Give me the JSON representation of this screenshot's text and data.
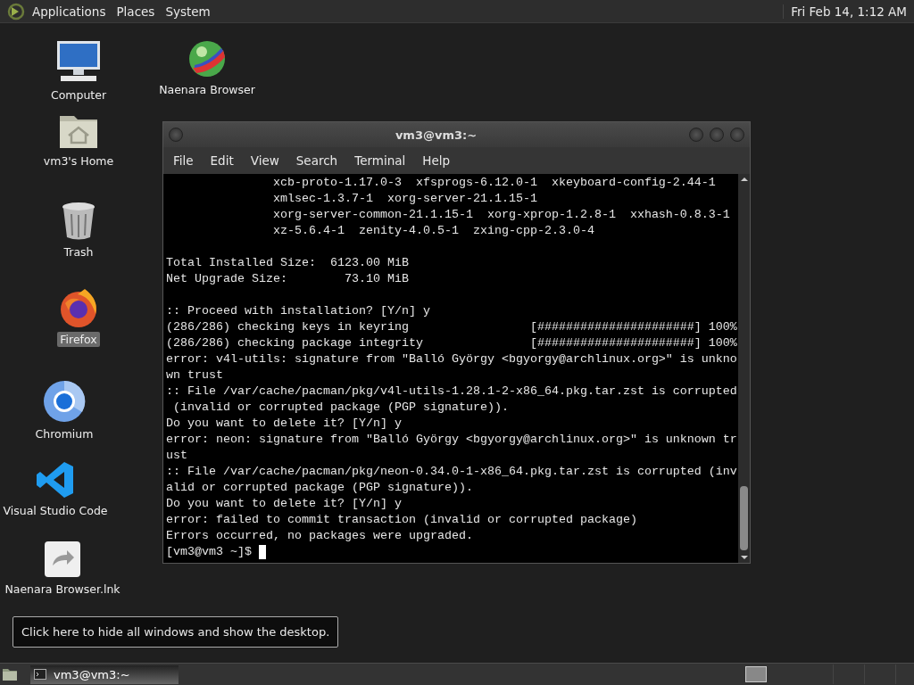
{
  "top_panel": {
    "menus": [
      "Applications",
      "Places",
      "System"
    ],
    "clock": "Fri Feb 14,  1:12 AM"
  },
  "desktop_icons": [
    {
      "kind": "computer",
      "label": "Computer",
      "selected": false
    },
    {
      "kind": "globe",
      "label": "Naenara Browser",
      "selected": false
    },
    {
      "kind": "home",
      "label": "vm3's Home",
      "selected": false
    },
    {
      "kind": "trash",
      "label": "Trash",
      "selected": false
    },
    {
      "kind": "firefox",
      "label": "Firefox",
      "selected": true
    },
    {
      "kind": "chromium",
      "label": "Chromium",
      "selected": false
    },
    {
      "kind": "vscode",
      "label": "Visual Studio Code",
      "selected": false
    },
    {
      "kind": "link",
      "label": "Naenara Browser.lnk",
      "selected": false
    }
  ],
  "terminal": {
    "title": "vm3@vm3:~",
    "menu": [
      "File",
      "Edit",
      "View",
      "Search",
      "Terminal",
      "Help"
    ],
    "blocks": [
      [
        "               xcb-proto-1.17.0-3  xfsprogs-6.12.0-1  xkeyboard-config-2.44-1",
        "               xmlsec-1.3.7-1  xorg-server-21.1.15-1",
        "               xorg-server-common-21.1.15-1  xorg-xprop-1.2.8-1  xxhash-0.8.3-1",
        "               xz-5.6.4-1  zenity-4.0.5-1  zxing-cpp-2.3.0-4"
      ],
      [
        "Total Installed Size:  6123.00 MiB",
        "Net Upgrade Size:        73.10 MiB"
      ],
      [
        ":: Proceed with installation? [Y/n] y",
        "(286/286) checking keys in keyring                 [######################] 100%",
        "(286/286) checking package integrity               [######################] 100%",
        "error: v4l-utils: signature from \"Balló György <bgyorgy@archlinux.org>\" is unkno",
        "wn trust",
        ":: File /var/cache/pacman/pkg/v4l-utils-1.28.1-2-x86_64.pkg.tar.zst is corrupted",
        " (invalid or corrupted package (PGP signature)).",
        "Do you want to delete it? [Y/n] y",
        "error: neon: signature from \"Balló György <bgyorgy@archlinux.org>\" is unknown tr",
        "ust",
        ":: File /var/cache/pacman/pkg/neon-0.34.0-1-x86_64.pkg.tar.zst is corrupted (inv",
        "alid or corrupted package (PGP signature)).",
        "Do you want to delete it? [Y/n] y",
        "error: failed to commit transaction (invalid or corrupted package)",
        "Errors occurred, no packages were upgraded."
      ]
    ],
    "prompt": "[vm3@vm3 ~]$"
  },
  "tooltip": "Click here to hide all windows and show the desktop.",
  "taskbar": {
    "tasks": [
      {
        "label": "vm3@vm3:~",
        "selected": true
      }
    ]
  }
}
